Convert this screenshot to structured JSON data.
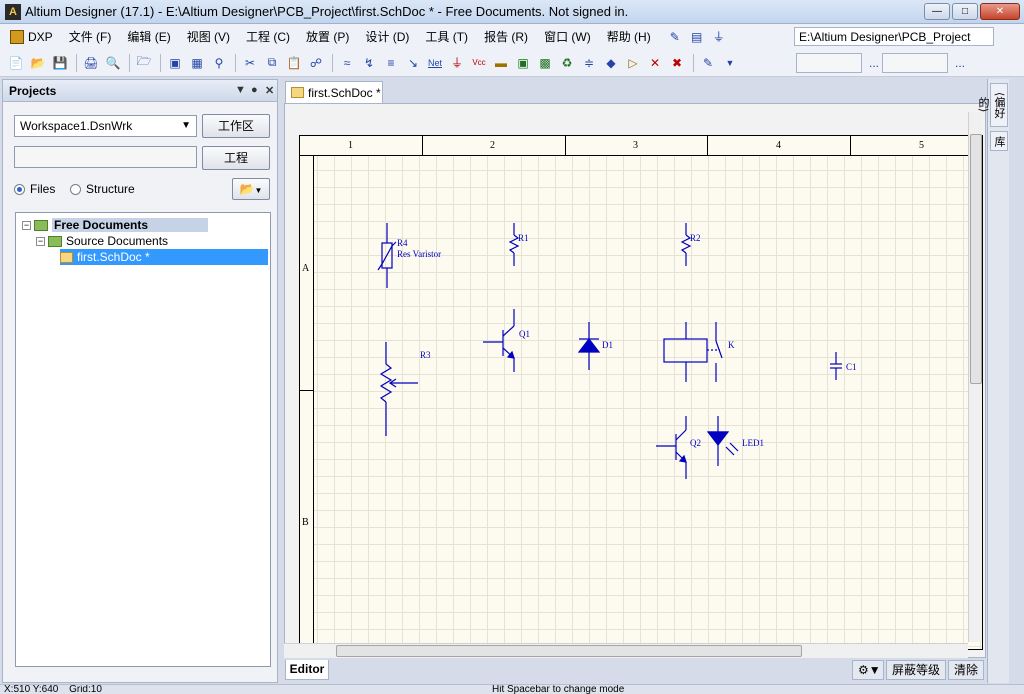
{
  "window": {
    "title": "Altium Designer (17.1) - E:\\Altium Designer\\PCB_Project\\first.SchDoc * - Free Documents. Not signed in."
  },
  "menubar": {
    "items": [
      "DXP",
      "文件 (F)",
      "编辑 (E)",
      "视图 (V)",
      "工程 (C)",
      "放置 (P)",
      "设计 (D)",
      "工具 (T)",
      "报告 (R)",
      "窗口 (W)",
      "帮助 (H)"
    ],
    "project_path": "E:\\Altium Designer\\PCB_Project"
  },
  "toolbar": {
    "net_label": "Net",
    "vcc_label": "Vcc",
    "more": "..."
  },
  "projects_panel": {
    "title": "Projects",
    "workspace_value": "Workspace1.DsnWrk",
    "workspace_button": "工作区",
    "project_input_value": "",
    "project_button": "工程",
    "radio_files": "Files",
    "radio_structure": "Structure",
    "tree": {
      "root": "Free Documents",
      "group": "Source Documents",
      "file": "first.SchDoc *"
    }
  },
  "document_tab": {
    "label": "first.SchDoc *"
  },
  "sheet": {
    "columns": [
      "1",
      "2",
      "3",
      "4",
      "5"
    ],
    "rows": [
      "A",
      "B"
    ]
  },
  "components": {
    "r4_designator": "R4",
    "r4_comment": "Res Varistor",
    "r1": "R1",
    "r2": "R2",
    "r3": "R3",
    "q1": "Q1",
    "d1": "D1",
    "k": "K",
    "c1": "C1",
    "q2": "Q2",
    "led1": "LED1"
  },
  "bottom": {
    "editor_tab": "Editor",
    "mask_level_button": "屏蔽等级",
    "clear_button": "清除"
  },
  "right_panels": [
    "⟨偏好的⟩",
    "库"
  ],
  "statusbar": {
    "coords": "X:510 Y:640",
    "grid": "Grid:10",
    "hint": "Hit Spacebar to change mode"
  },
  "colors": {
    "component_blue": "#0000c0",
    "sheet_background": "#fdfbf0",
    "selection_blue": "#3399ff"
  }
}
